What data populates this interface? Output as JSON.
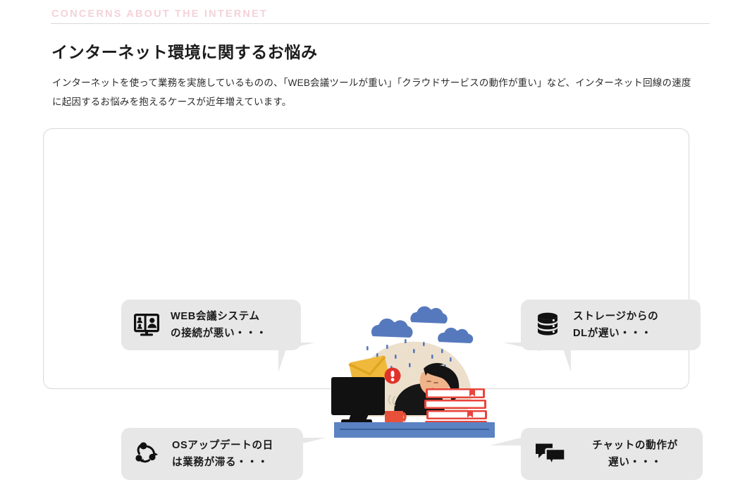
{
  "header": {
    "eyebrow": "CONCERNS ABOUT THE INTERNET",
    "title": "インターネット環境に関するお悩み",
    "lede": "インターネットを使って業務を実施しているものの、「WEB会議ツールが重い」「クラウドサービスの動作が重い」など、インターネット回線の速度に起因するお悩みを抱えるケースが近年増えています。",
    "eyebrow_color": "#f4d2d9",
    "title_color": "#1c1c1c",
    "rule_color": "#d9d9d9"
  },
  "card": {
    "border_color": "#d8d8d8",
    "background": "#ffffff"
  },
  "bubbles": [
    {
      "id": "top-left",
      "icon": "video-conference-icon",
      "text": "WEB会議システム\nの接続が悪い・・・",
      "background": "#e7e7e7",
      "text_color": "#1a1a1a"
    },
    {
      "id": "top-right",
      "icon": "database-storage-icon",
      "text": "ストレージからの\nDLが遅い・・・",
      "background": "#e7e7e7",
      "text_color": "#1a1a1a"
    },
    {
      "id": "bottom-left",
      "icon": "update-cycle-icon",
      "text": "OSアップデートの日\nは業務が滞る・・・",
      "background": "#e7e7e7",
      "text_color": "#1a1a1a"
    },
    {
      "id": "bottom-right",
      "icon": "chat-bubbles-icon",
      "text": "チャットの動作が\n遅い・・・",
      "background": "#e7e7e7",
      "text_color": "#1a1a1a"
    }
  ],
  "illustration": {
    "name": "tired-worker-at-desk-with-rain-clouds",
    "alt": "疲れた様子で本の山に伏せる人物とパソコン、雨雲のイラスト",
    "colors": {
      "cloud": "#5679bd",
      "cloud_outline": "#ffffff",
      "raindrop": "#5679bd",
      "backdrop_blob": "#ece0cd",
      "desk": "#5b82c2",
      "desk_line": "#3c5f99",
      "monitor": "#111111",
      "book_cover": "#e8453c",
      "book_pages": "#ffffff",
      "envelope": "#f0b93c",
      "alert_badge": "#e0322a",
      "mug": "#e8503a",
      "skin": "#f0b48a",
      "hand_skin": "#b9764a",
      "hair": "#141414",
      "shirt": "#161616"
    }
  }
}
